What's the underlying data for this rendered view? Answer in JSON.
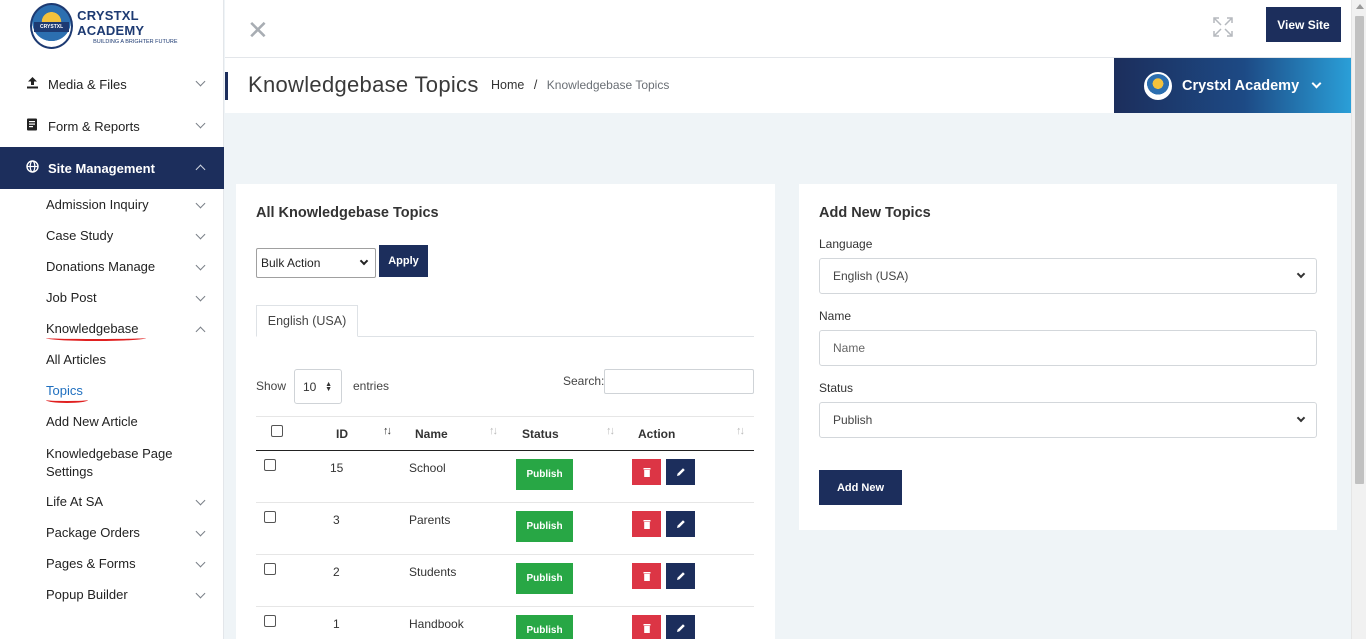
{
  "brand": {
    "logo_name": "CRYSTXL ACADEMY",
    "logo_tagline": "BUILDING A BRIGHTER FUTURE",
    "seal_text": "CRYSTXL"
  },
  "sidebar": {
    "top_items": [
      {
        "label": "Media & Files",
        "icon": "upload-icon"
      },
      {
        "label": "Form & Reports",
        "icon": "document-icon"
      },
      {
        "label": "Site Management",
        "icon": "globe-icon"
      }
    ],
    "sub_items": [
      {
        "label": "Admission Inquiry"
      },
      {
        "label": "Case Study"
      },
      {
        "label": "Donations Manage"
      },
      {
        "label": "Job Post"
      },
      {
        "label": "Knowledgebase"
      },
      {
        "label": "All Articles"
      },
      {
        "label": "Topics"
      },
      {
        "label": "Add New Article"
      },
      {
        "label": "Knowledgebase Page Settings"
      },
      {
        "label": "Life At SA"
      },
      {
        "label": "Package Orders"
      },
      {
        "label": "Pages & Forms"
      },
      {
        "label": "Popup Builder"
      }
    ]
  },
  "header": {
    "view_site": "View Site",
    "close_icon": "close-icon",
    "expand_icon": "expand-icon"
  },
  "titlebar": {
    "title": "Knowledgebase Topics",
    "breadcrumb_home": "Home",
    "breadcrumb_sep": "/",
    "breadcrumb_current": "Knowledgebase Topics",
    "account_name": "Crystxl Academy"
  },
  "topics": {
    "title": "All Knowledgebase Topics",
    "bulk_action": "Bulk Action",
    "apply": "Apply",
    "tab": "English (USA)",
    "show": "Show",
    "page_length": "10",
    "entries": "entries",
    "search_label": "Search:",
    "columns": {
      "id": "ID",
      "name": "Name",
      "status": "Status",
      "action": "Action"
    },
    "rows": [
      {
        "id": "15",
        "name": "School",
        "status": "Publish"
      },
      {
        "id": "3",
        "name": "Parents",
        "status": "Publish"
      },
      {
        "id": "2",
        "name": "Students",
        "status": "Publish"
      },
      {
        "id": "1",
        "name": "Handbook",
        "status": "Publish"
      }
    ]
  },
  "add_form": {
    "title": "Add New Topics",
    "language_label": "Language",
    "language_value": "English (USA)",
    "name_label": "Name",
    "name_placeholder": "Name",
    "status_label": "Status",
    "status_value": "Publish",
    "submit": "Add New"
  },
  "colors": {
    "primary": "#1c2e5c",
    "publish": "#28a745",
    "delete": "#dc3545",
    "link": "#1f6fbf",
    "background": "#eff4f7"
  }
}
